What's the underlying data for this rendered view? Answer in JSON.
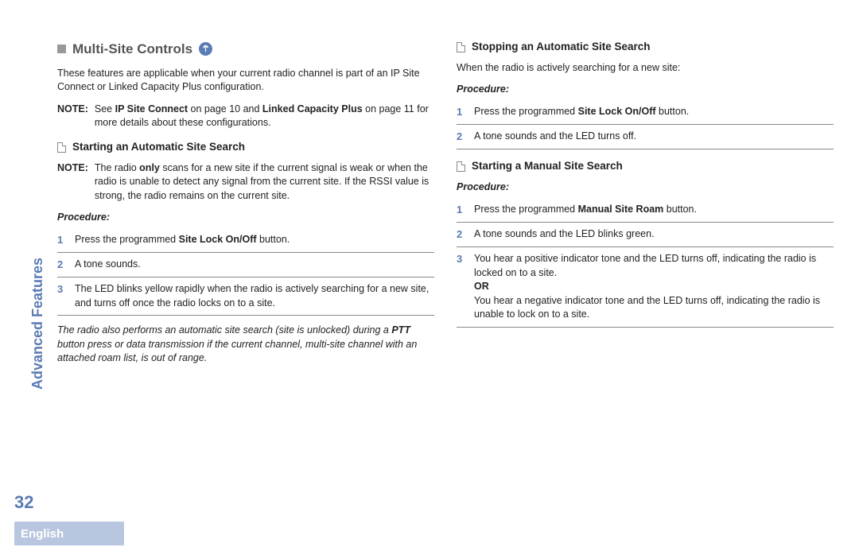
{
  "sidebar": {
    "label": "Advanced Features"
  },
  "page_number": "32",
  "footer": {
    "language": "English"
  },
  "left": {
    "heading": "Multi-Site Controls",
    "intro": "These features are applicable when your current radio channel is part of an IP Site Connect or Linked Capacity Plus configuration.",
    "note_label": "NOTE:",
    "note1_a": "See ",
    "note1_b": "IP Site Connect",
    "note1_c": " on page 10 and ",
    "note1_d": "Linked Capacity Plus",
    "note1_e": " on page 11 for more details about these configurations.",
    "sub1": "Starting an Automatic Site Search",
    "note2_a": "The radio ",
    "note2_b": "only",
    "note2_c": " scans for a new site if the current signal is weak or when the radio is unable to detect any signal from the current site. If the RSSI value is strong, the radio remains on the current site.",
    "procedure_label": "Procedure:",
    "steps1": {
      "s1a": "Press the programmed ",
      "s1b": "Site Lock On/Off",
      "s1c": " button.",
      "s2": "A tone sounds.",
      "s3": "The LED blinks yellow rapidly when the radio is actively searching for a new site, and turns off once the radio locks on to a site."
    },
    "italic_a": "The radio also performs an automatic site search (site is unlocked) during a ",
    "italic_b": "PTT",
    "italic_c": " button press or data transmission if the current channel, multi-site channel with an attached roam list, is out of range."
  },
  "right": {
    "sub1": "Stopping an Automatic Site Search",
    "intro1": "When the radio is actively searching for a new site:",
    "procedure_label": "Procedure:",
    "steps1": {
      "s1a": "Press the programmed ",
      "s1b": "Site Lock On/Off",
      "s1c": " button.",
      "s2": "A tone sounds and the LED turns off."
    },
    "sub2": "Starting a Manual Site Search",
    "steps2": {
      "s1a": "Press the programmed ",
      "s1b": "Manual Site Roam",
      "s1c": " button.",
      "s2": "A tone sounds and the LED blinks green.",
      "s3a": "You hear a positive indicator tone and the LED turns off, indicating the radio is locked on to a site.",
      "or": "OR",
      "s3b": "You hear a negative indicator tone and the LED turns off, indicating the radio is unable to lock on to a site."
    }
  }
}
